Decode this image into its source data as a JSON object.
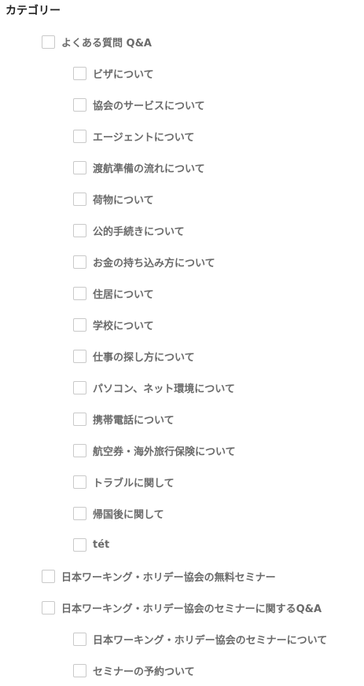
{
  "title": "カテゴリー",
  "categories": [
    {
      "label": "よくある質問 Q&A",
      "level": 1,
      "checked": false
    },
    {
      "label": "ビザについて",
      "level": 2,
      "checked": false
    },
    {
      "label": "協会のサービスについて",
      "level": 2,
      "checked": false
    },
    {
      "label": "エージェントについて",
      "level": 2,
      "checked": false
    },
    {
      "label": "渡航準備の流れについて",
      "level": 2,
      "checked": false
    },
    {
      "label": "荷物について",
      "level": 2,
      "checked": false
    },
    {
      "label": "公的手続きについて",
      "level": 2,
      "checked": false
    },
    {
      "label": "お金の持ち込み方について",
      "level": 2,
      "checked": false
    },
    {
      "label": "住居について",
      "level": 2,
      "checked": false
    },
    {
      "label": "学校について",
      "level": 2,
      "checked": false
    },
    {
      "label": "仕事の探し方について",
      "level": 2,
      "checked": false
    },
    {
      "label": "パソコン、ネット環境について",
      "level": 2,
      "checked": false
    },
    {
      "label": "携帯電話について",
      "level": 2,
      "checked": false
    },
    {
      "label": "航空券・海外旅行保険について",
      "level": 2,
      "checked": false
    },
    {
      "label": "トラブルに関して",
      "level": 2,
      "checked": false
    },
    {
      "label": "帰国後に関して",
      "level": 2,
      "checked": false
    },
    {
      "label": "tét",
      "level": 2,
      "checked": false
    },
    {
      "label": "日本ワーキング・ホリデー協会の無料セミナー",
      "level": 1,
      "checked": false
    },
    {
      "label": "日本ワーキング・ホリデー協会のセミナーに関するQ&A",
      "level": 1,
      "checked": false
    },
    {
      "label": "日本ワーキング・ホリデー協会のセミナーについて",
      "level": 2,
      "checked": false
    },
    {
      "label": "セミナーの予約ついて",
      "level": 2,
      "checked": false
    }
  ]
}
